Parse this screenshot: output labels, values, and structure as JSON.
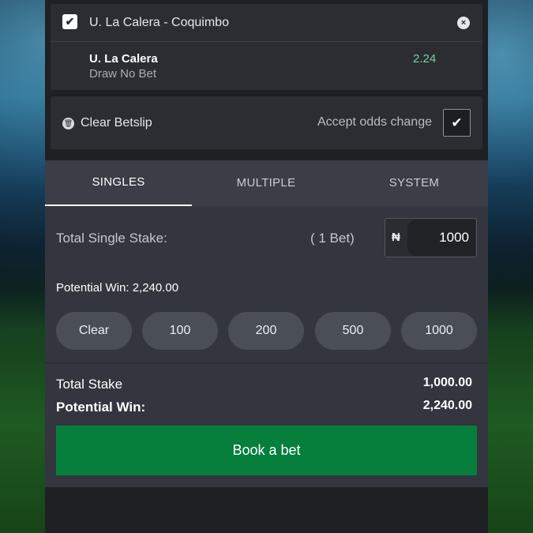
{
  "event": {
    "title": "U. La Calera - Coquimbo",
    "checkbox_glyph": "✔",
    "close_glyph": "×",
    "selection_team": "U. La Calera",
    "selection_market": "Draw No Bet",
    "odds": "2.24"
  },
  "actions": {
    "trash_glyph": "🗑",
    "clear_betslip": "Clear Betslip",
    "accept_odds": "Accept odds change",
    "accept_glyph": "✔"
  },
  "tabs": [
    {
      "label": "SINGLES"
    },
    {
      "label": "MULTIPLE"
    },
    {
      "label": "SYSTEM"
    }
  ],
  "stake": {
    "label": "Total Single Stake:",
    "bets_count": "( 1 Bet)",
    "currency": "₦",
    "value": "1000",
    "potential_win_line": "Potential Win: 2,240.00"
  },
  "quick_chips": [
    {
      "label": "Clear"
    },
    {
      "label": "100"
    },
    {
      "label": "200"
    },
    {
      "label": "500"
    },
    {
      "label": "1000"
    }
  ],
  "summary": {
    "total_stake_label": "Total Stake",
    "total_stake_value": "1,000.00",
    "potential_win_label": "Potential Win:",
    "potential_win_value": "2,240.00",
    "book_button": "Book a bet"
  },
  "colors": {
    "accent_green": "#067f3c",
    "odds_green": "#78d19a",
    "panel_bg": "#1e2024",
    "card_bg": "#2b2d33"
  }
}
